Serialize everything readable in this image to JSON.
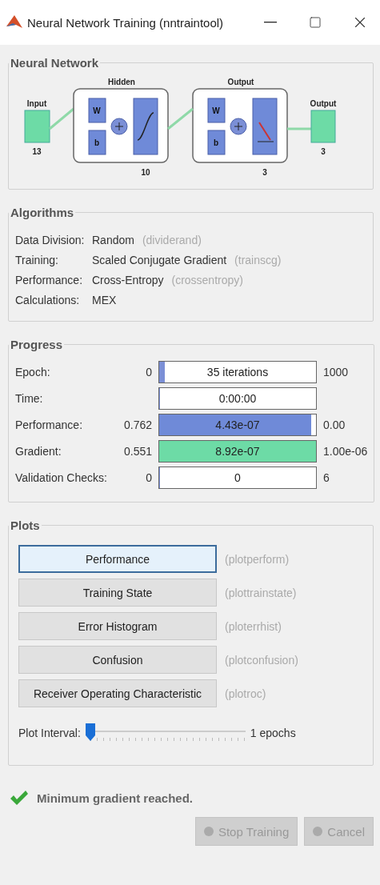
{
  "window": {
    "title": "Neural Network Training (nntraintool)"
  },
  "neural_network": {
    "title": "Neural Network",
    "input": {
      "label": "Input",
      "size": "13"
    },
    "layers": [
      {
        "title": "Hidden",
        "size": "10",
        "weight": "W",
        "bias": "b",
        "kind": "tansig"
      },
      {
        "title": "Output",
        "size": "3",
        "weight": "W",
        "bias": "b",
        "kind": "softmax"
      }
    ],
    "output": {
      "label": "Output",
      "size": "3"
    }
  },
  "algorithms": {
    "title": "Algorithms",
    "rows": [
      {
        "label": "Data Division:",
        "value": "Random",
        "function": "(dividerand)"
      },
      {
        "label": "Training:",
        "value": "Scaled Conjugate Gradient",
        "function": "(trainscg)"
      },
      {
        "label": "Performance:",
        "value": "Cross-Entropy",
        "function": "(crossentropy)"
      },
      {
        "label": "Calculations:",
        "value": "MEX"
      }
    ]
  },
  "progress": {
    "title": "Progress",
    "rows": [
      {
        "label": "Epoch:",
        "start": "0",
        "bar_text": "35 iterations",
        "level": 0.035,
        "color": "#7b8fd6",
        "end": "1000"
      },
      {
        "label": "Time:",
        "bar_text": "0:00:00",
        "level": 0,
        "color": "#7b8fd6"
      },
      {
        "label": "Performance:",
        "start": "0.762",
        "bar_text": "4.43e-07",
        "level": 0.97,
        "color": "#6f8ad8",
        "end": "0.00"
      },
      {
        "label": "Gradient:",
        "start": "0.551",
        "bar_text": "8.92e-07",
        "level": 1,
        "color": "#6ddba6",
        "end": "1.00e-06"
      },
      {
        "label": "Validation Checks:",
        "start": "0",
        "bar_text": "0",
        "level": 0,
        "color": "#7b8fd6",
        "end": "6"
      }
    ]
  },
  "plots": {
    "title": "Plots",
    "buttons": [
      {
        "label": "Performance",
        "function": "(plotperform)",
        "selected": true
      },
      {
        "label": "Training State",
        "function": "(plottrainstate)",
        "selected": false
      },
      {
        "label": "Error Histogram",
        "function": "(ploterrhist)",
        "selected": false
      },
      {
        "label": "Confusion",
        "function": "(plotconfusion)",
        "selected": false
      },
      {
        "label": "Receiver Operating Characteristic",
        "function": "(plotroc)",
        "selected": false
      }
    ],
    "interval": {
      "label": "Plot Interval:",
      "level": 0,
      "reading": "1 epochs"
    }
  },
  "status": {
    "message": "Minimum gradient reached."
  },
  "buttons": [
    {
      "label": "Stop Training",
      "disabled": true
    },
    {
      "label": "Cancel",
      "disabled": true
    }
  ]
}
